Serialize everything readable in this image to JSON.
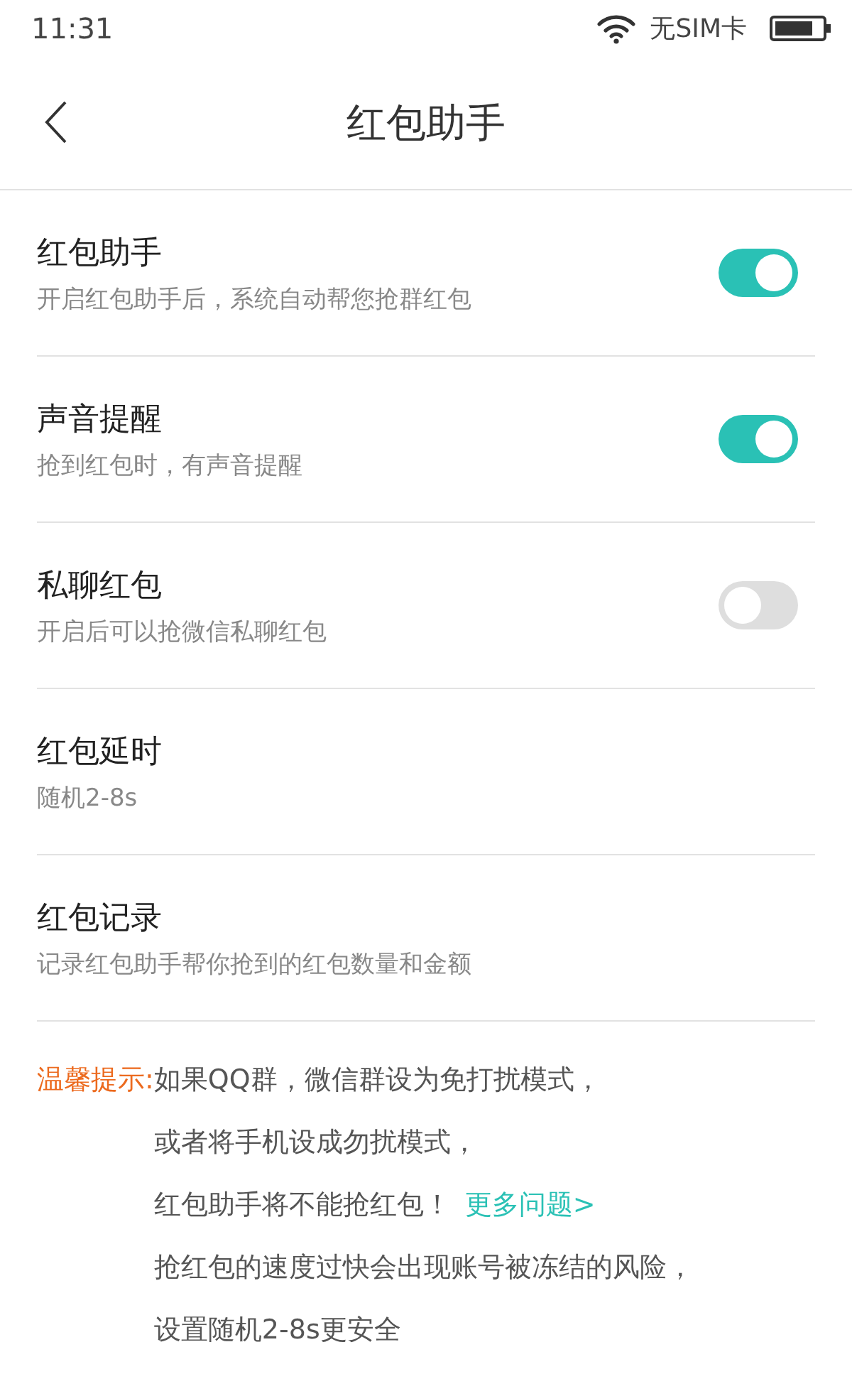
{
  "status_bar": {
    "time": "11:31",
    "carrier": "无SIM卡"
  },
  "nav": {
    "title": "红包助手"
  },
  "settings": [
    {
      "kind": "toggle",
      "title": "红包助手",
      "subtitle": "开启红包助手后，系统自动帮您抢群红包",
      "on": true
    },
    {
      "kind": "toggle",
      "title": "声音提醒",
      "subtitle": "抢到红包时，有声音提醒",
      "on": true
    },
    {
      "kind": "toggle",
      "title": "私聊红包",
      "subtitle": "开启后可以抢微信私聊红包",
      "on": false
    },
    {
      "kind": "plain",
      "title": "红包延时",
      "subtitle": "随机2-8s"
    },
    {
      "kind": "plain",
      "title": "红包记录",
      "subtitle": "记录红包助手帮你抢到的红包数量和金额"
    }
  ],
  "tip": {
    "label": "温馨提示:",
    "lines": [
      {
        "text": "如果QQ群，微信群设为免打扰模式，"
      },
      {
        "text": "或者将手机设成勿扰模式，"
      },
      {
        "text": "红包助手将不能抢红包！",
        "link": "更多问题>"
      },
      {
        "text": "抢红包的速度过快会出现账号被冻结的风险，"
      },
      {
        "text": "设置随机2-8s更安全"
      }
    ]
  }
}
